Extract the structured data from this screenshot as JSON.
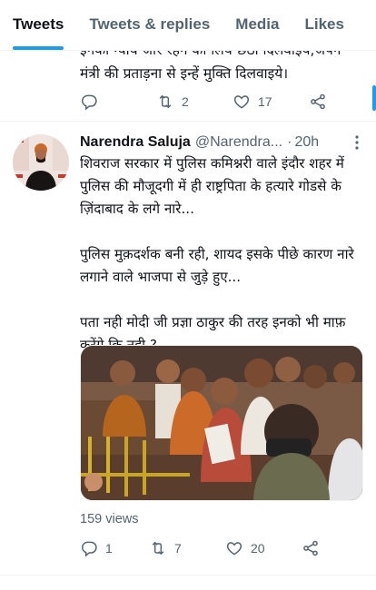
{
  "tabs": [
    {
      "label": "Tweets",
      "active": true
    },
    {
      "label": "Tweets & replies",
      "active": false
    },
    {
      "label": "Media",
      "active": false
    },
    {
      "label": "Likes",
      "active": false
    }
  ],
  "previous_tweet": {
    "text_line1": "इनका न्याय जार रहन का लिय छठा दिलवाइय,जपन",
    "text_line2": "मंत्री की प्रताड़ना से इन्हें मुक्ति दिलवाइये।",
    "replies": "",
    "retweets": "2",
    "likes": "17"
  },
  "tweet": {
    "display_name": "Narendra Saluja",
    "handle": "@Narendra...",
    "separator": "·",
    "time": "20h",
    "text": "शिवराज सरकार में पुलिस कमिश्नरी वाले इंदौर शहर में पुलिस की मौजूदगी में ही राष्ट्रपिता के हत्यारे गोडसे के ज़िंदाबाद के लगे नारे...\n\nपुलिस मुक़दर्शक बनी रही, शायद इसके पीछे कारण नारे लगाने वाले भाजपा से जुड़े हुए...\n\nपता नही मोदी जी प्रज्ञा ठाकुर की तरह इनको भी माफ़ करेंगे कि नही ?",
    "views": "159 views",
    "replies": "1",
    "retweets": "7",
    "likes": "20"
  },
  "colors": {
    "accent": "#1d9bf0",
    "secondary_text": "#536471",
    "divider": "#eff3f4"
  },
  "icons": [
    "reply-icon",
    "retweet-icon",
    "like-icon",
    "share-icon",
    "more-icon"
  ]
}
